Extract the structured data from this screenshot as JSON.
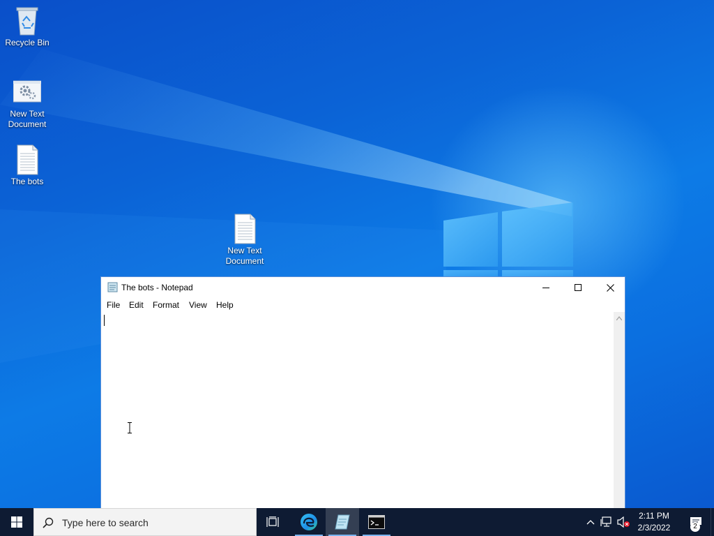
{
  "desktop": {
    "icons": [
      {
        "label": "Recycle Bin",
        "icon": "recycle-bin-icon"
      },
      {
        "label": "New Text Document",
        "icon": "settings-file-icon"
      },
      {
        "label": "The bots",
        "icon": "text-file-icon"
      },
      {
        "label": "New Text Document",
        "icon": "text-file-icon"
      }
    ]
  },
  "notepad": {
    "title": "The bots - Notepad",
    "menu": [
      "File",
      "Edit",
      "Format",
      "View",
      "Help"
    ],
    "content": ""
  },
  "taskbar": {
    "search_placeholder": "Type here to search",
    "apps": [
      "task-view-icon",
      "edge-icon",
      "notepad-icon",
      "terminal-icon"
    ],
    "clock": {
      "time": "2:11 PM",
      "date": "2/3/2022"
    },
    "notification_count": "2"
  },
  "colors": {
    "wallpaper": "#0b63d6",
    "taskbar": "#0e1b33",
    "accent": "#7ab4f0"
  }
}
